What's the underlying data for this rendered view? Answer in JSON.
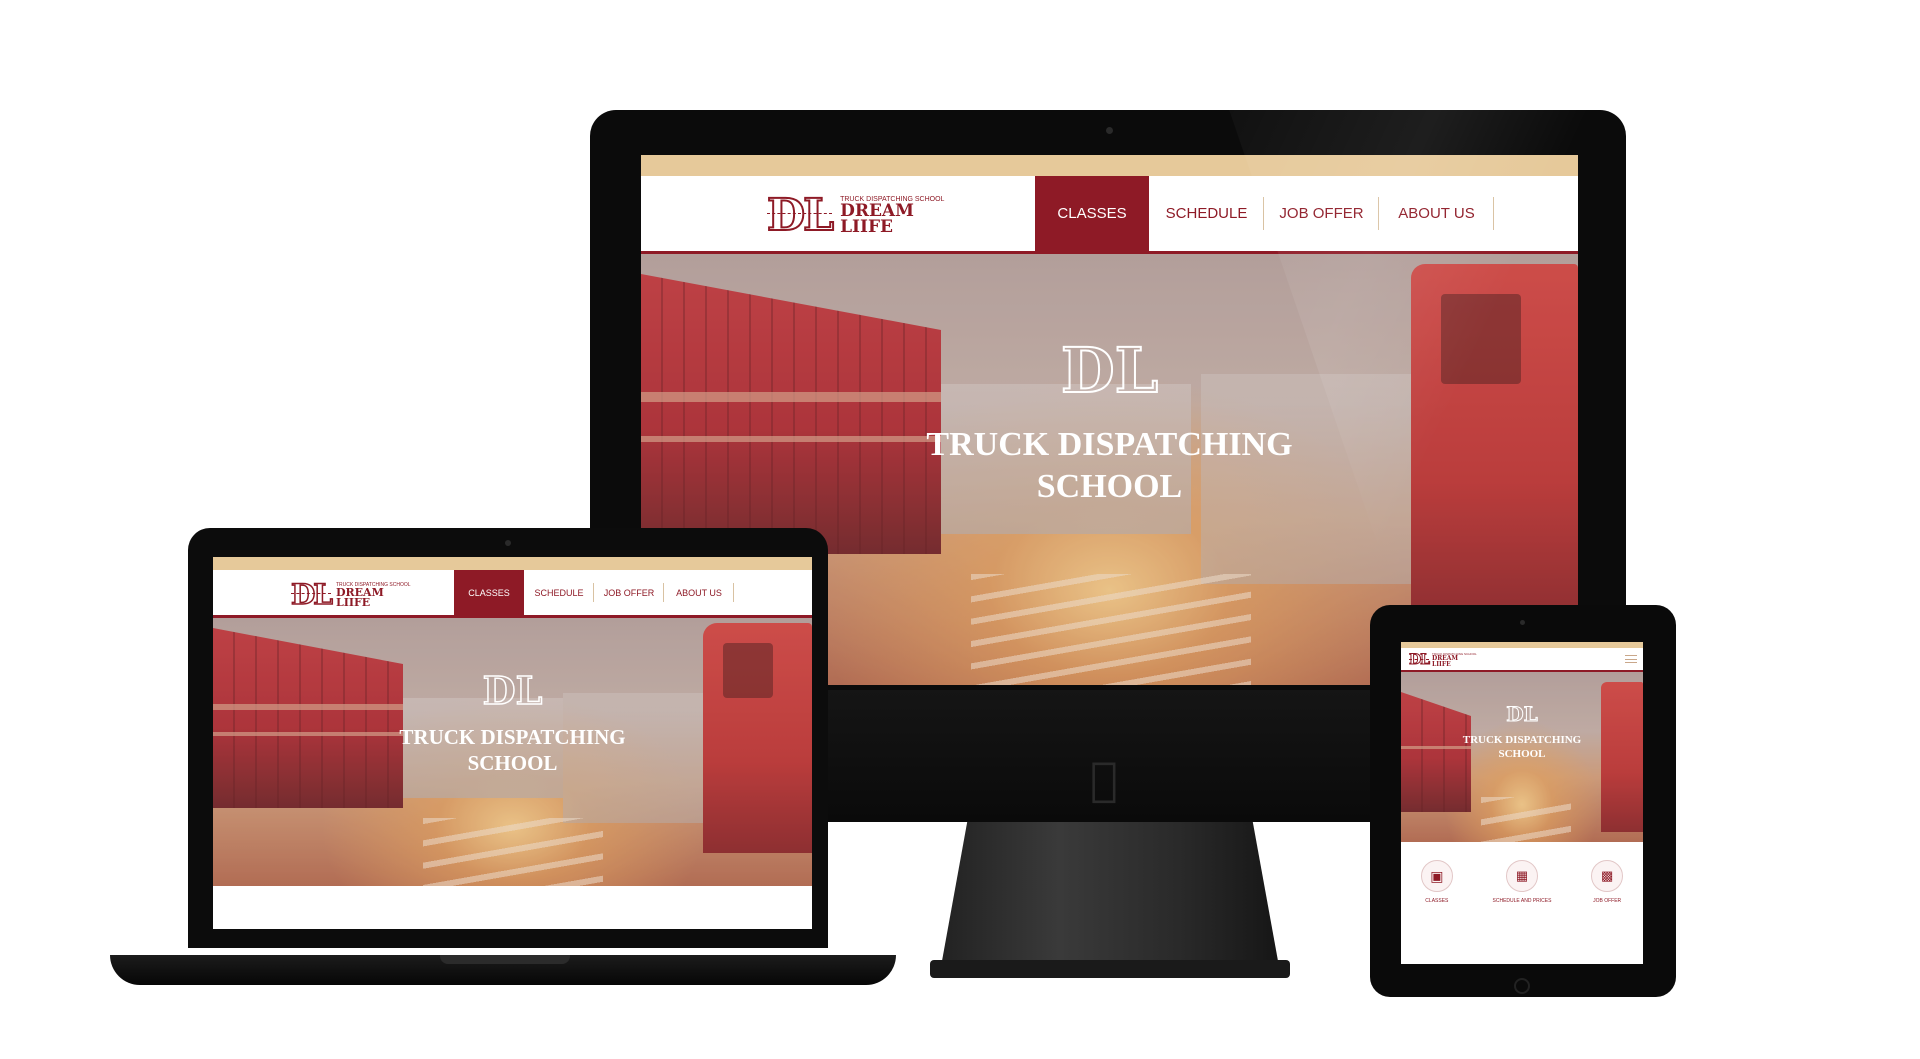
{
  "site": {
    "logo": {
      "mark": "DL",
      "subtitle": "TRUCK DISPATCHING SCHOOL",
      "name_line1": "DREAM",
      "name_line2": "LIIFE"
    },
    "nav": [
      {
        "label": "CLASSES",
        "active": true
      },
      {
        "label": "SCHEDULE",
        "active": false
      },
      {
        "label": "JOB OFFER",
        "active": false
      },
      {
        "label": "ABOUT US",
        "active": false
      }
    ],
    "hero": {
      "mark": "DL",
      "title_line1": "TRUCK DISPATCHING",
      "title_line2": "SCHOOL"
    },
    "features": [
      {
        "label": "CLASSES",
        "icon": "monitor-icon"
      },
      {
        "label": "SCHEDULE AND PRICES",
        "icon": "calendar-icon"
      },
      {
        "label": "JOB OFFER",
        "icon": "briefcase-icon"
      }
    ]
  },
  "colors": {
    "brand": "#8e1a26",
    "topstrip": "#e6c99a",
    "device": "#0b0b0b"
  }
}
